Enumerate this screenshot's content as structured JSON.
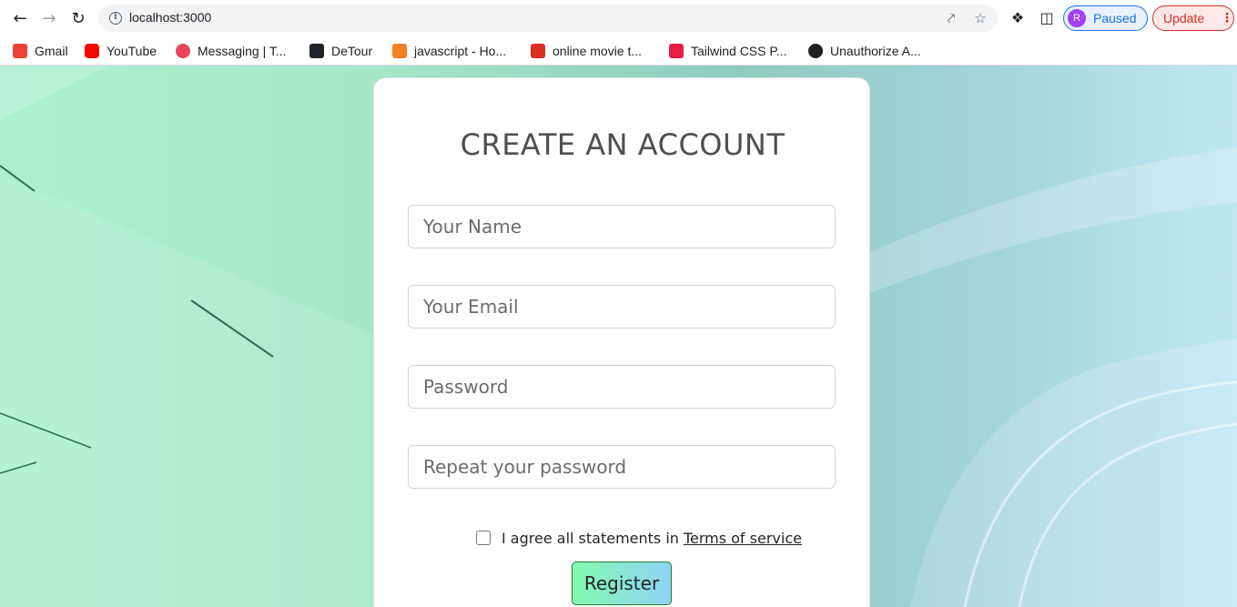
{
  "browser": {
    "url": "localhost:3000",
    "profile_initial": "R",
    "profile_status": "Paused",
    "update_label": "Update",
    "bookmarks": [
      {
        "label": "Gmail",
        "icon": "gmail-icon",
        "color": "#ea4335"
      },
      {
        "label": "YouTube",
        "icon": "youtube-icon",
        "color": "#ff0000"
      },
      {
        "label": "Messaging | T...",
        "icon": "messaging-icon",
        "color": "#e8455a"
      },
      {
        "label": "DeTour",
        "icon": "detour-icon",
        "color": "#20232a"
      },
      {
        "label": "javascript - Ho...",
        "icon": "stackoverflow-icon",
        "color": "#f48024"
      },
      {
        "label": "online movie t...",
        "icon": "link-icon",
        "color": "#d93025"
      },
      {
        "label": "Tailwind CSS P...",
        "icon": "tailwind-icon",
        "color": "#e11d48"
      },
      {
        "label": "Unauthorize A...",
        "icon": "globe-icon",
        "color": "#202124"
      }
    ]
  },
  "form": {
    "title": "CREATE AN ACCOUNT",
    "name_placeholder": "Your Name",
    "email_placeholder": "Your Email",
    "password_placeholder": "Password",
    "repeat_password_placeholder": "Repeat your password",
    "agree_text": "I agree all statements in",
    "terms_link": "Terms of service",
    "register_label": "Register"
  },
  "colors": {
    "gradient_start": "#84fab0",
    "gradient_end": "#8fd3f4"
  }
}
